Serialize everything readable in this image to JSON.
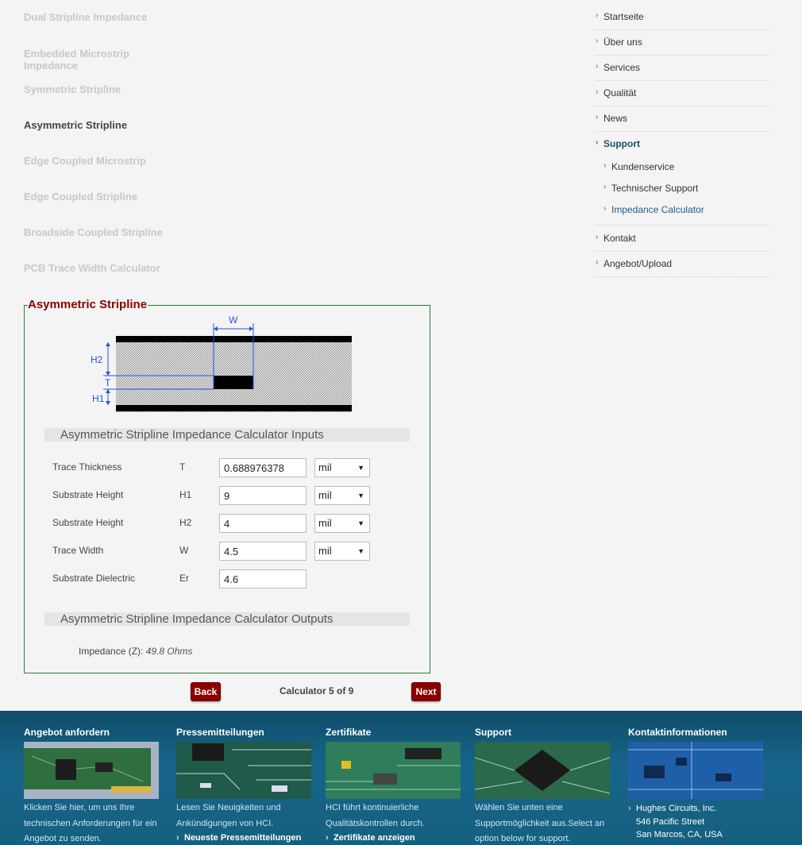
{
  "calculators": [
    {
      "label": "Dual Stripline Impedance",
      "active": false
    },
    {
      "label": "Embedded Microstrip Impedance",
      "active": false
    },
    {
      "label": "Symmetric Stripline",
      "active": false
    },
    {
      "label": "Asymmetric Stripline",
      "active": true
    },
    {
      "label": "Edge Coupled Microstrip",
      "active": false
    },
    {
      "label": "Edge Coupled Stripline",
      "active": false
    },
    {
      "label": "Broadside Coupled Stripline",
      "active": false
    },
    {
      "label": "PCB Trace Width Calculator",
      "active": false
    }
  ],
  "nav": {
    "items": [
      "Startseite",
      "Über uns",
      "Services",
      "Qualität",
      "News",
      "Support"
    ],
    "sub_items": [
      "Kundenservice",
      "Technischer Support",
      "Impedance Calculator"
    ],
    "after_items": [
      "Kontakt",
      "Angebot/Upload"
    ]
  },
  "calculator": {
    "title": "Asymmetric Stripline",
    "diagram_labels": {
      "w": "W",
      "h2": "H2",
      "t": "T",
      "h1": "H1"
    },
    "inputs_heading": "Asymmetric Stripline Impedance Calculator Inputs",
    "outputs_heading": "Asymmetric Stripline Impedance Calculator Outputs",
    "rows": [
      {
        "label": "Trace Thickness",
        "symbol": "T",
        "value": "0.688976378",
        "unit": "mil"
      },
      {
        "label": "Substrate Height",
        "symbol": "H1",
        "value": "9",
        "unit": "mil"
      },
      {
        "label": "Substrate Height",
        "symbol": "H2",
        "value": "4",
        "unit": "mil"
      },
      {
        "label": "Trace Width",
        "symbol": "W",
        "value": "4.5",
        "unit": "mil"
      },
      {
        "label": "Substrate Dielectric",
        "symbol": "Er",
        "value": "4.6",
        "unit": ""
      }
    ],
    "impedance_label": "Impedance (Z):",
    "impedance_value": "49.8 Ohms"
  },
  "pager": {
    "back": "Back",
    "next": "Next",
    "status": "Calculator 5 of 9"
  },
  "footer": {
    "quote": {
      "title": "Angebot anfordern",
      "text": [
        "Klicken Sie hier, um uns Ihre",
        "technischen Anforderungen für ein",
        "Angebot zu senden."
      ]
    },
    "press": {
      "title": "Pressemitteilungen",
      "text": [
        "Lesen Sie Neuigkeiten und",
        "Ankündigungen von HCI."
      ],
      "link": "Neueste Pressemitteilungen"
    },
    "certs": {
      "title": "Zertifikate",
      "text": [
        "HCI führt kontinuierliche",
        "Qualitätskontrollen durch."
      ],
      "link": "Zertifikate anzeigen"
    },
    "support": {
      "title": "Support",
      "text": [
        "Wählen Sie unten eine",
        "Supportmöglichkeit aus.Select an",
        "option below for support."
      ]
    },
    "contact": {
      "title": "Kontaktinformationen",
      "address": [
        "Hughes Circuits, Inc.",
        "546 Pacific Street",
        "San Marcos, CA, USA"
      ]
    }
  },
  "colors": {
    "title_red": "#8b0000",
    "box_border": "#2e7d32",
    "diagram_blue": "#2255dd",
    "footer_blue": "#15607f"
  }
}
